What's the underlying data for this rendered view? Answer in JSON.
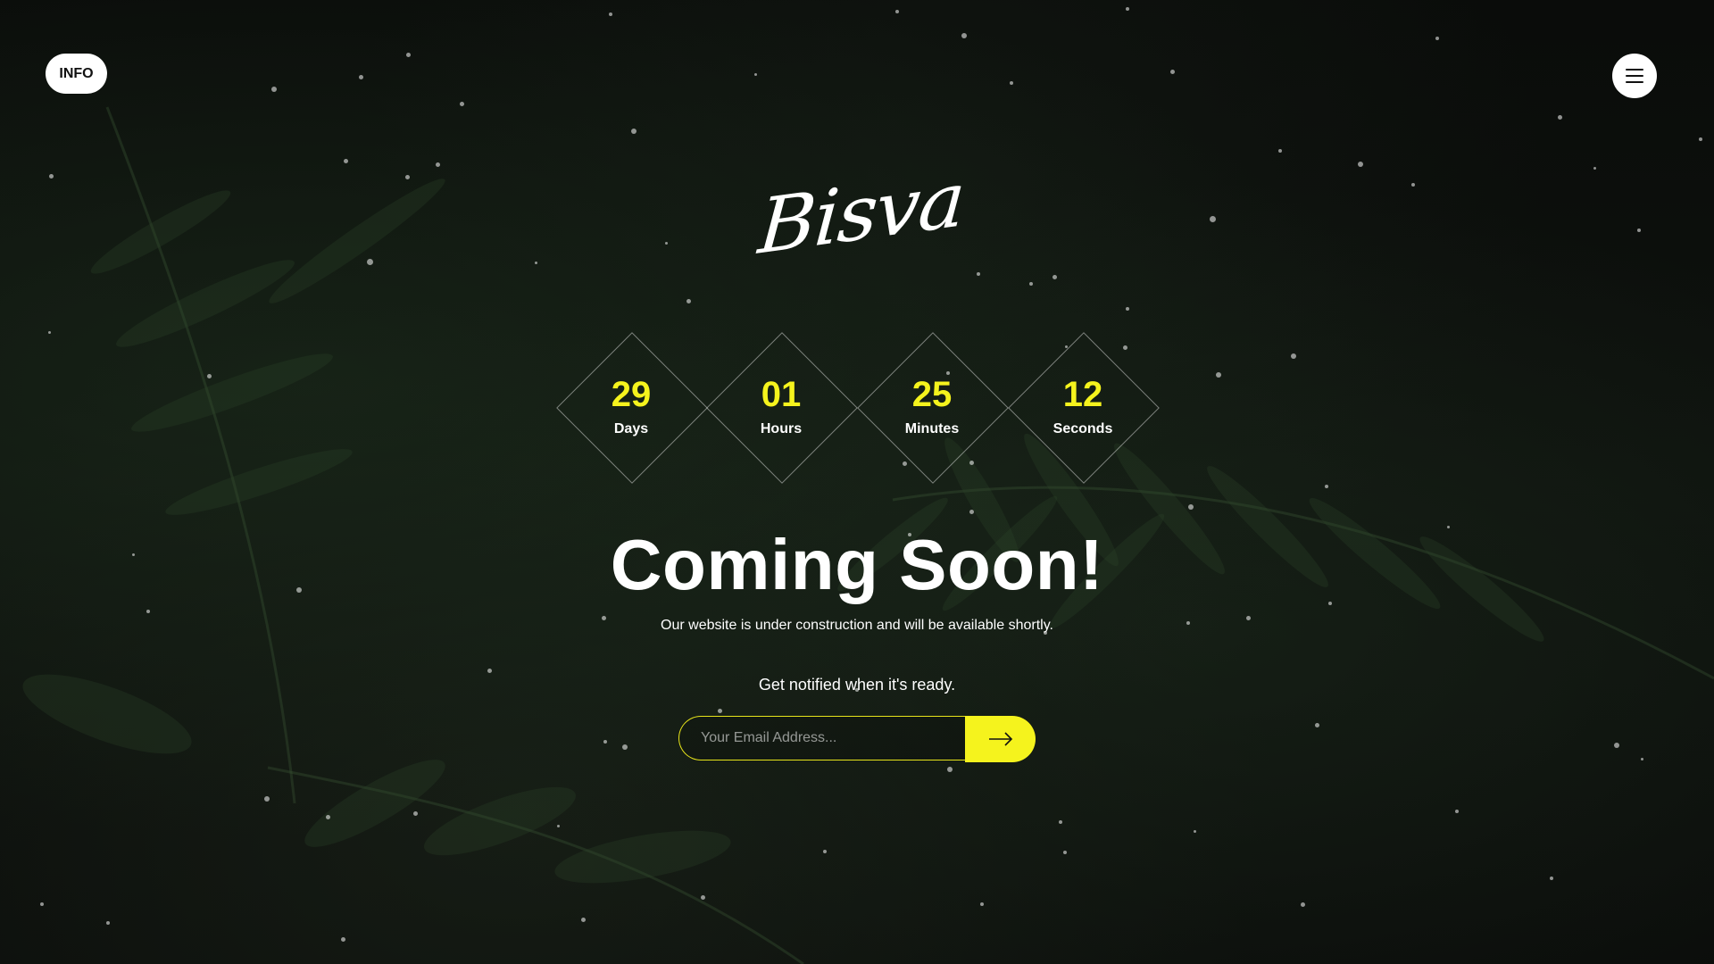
{
  "header": {
    "info_label": "INFO",
    "menu_icon": "hamburger-menu-icon"
  },
  "brand": {
    "logo_text": "Bisva"
  },
  "countdown": [
    {
      "value": "29",
      "label": "Days"
    },
    {
      "value": "01",
      "label": "Hours"
    },
    {
      "value": "25",
      "label": "Minutes"
    },
    {
      "value": "12",
      "label": "Seconds"
    }
  ],
  "main": {
    "headline": "Coming Soon!",
    "subline": "Our website is under construction and will be available shortly.",
    "notify_text": "Get notified when it's ready."
  },
  "subscribe": {
    "email_placeholder": "Your Email Address...",
    "email_value": "",
    "submit_icon": "arrow-right-icon"
  },
  "colors": {
    "accent": "#f5f31d",
    "background": "#0b0d0b",
    "text": "#ffffff"
  }
}
